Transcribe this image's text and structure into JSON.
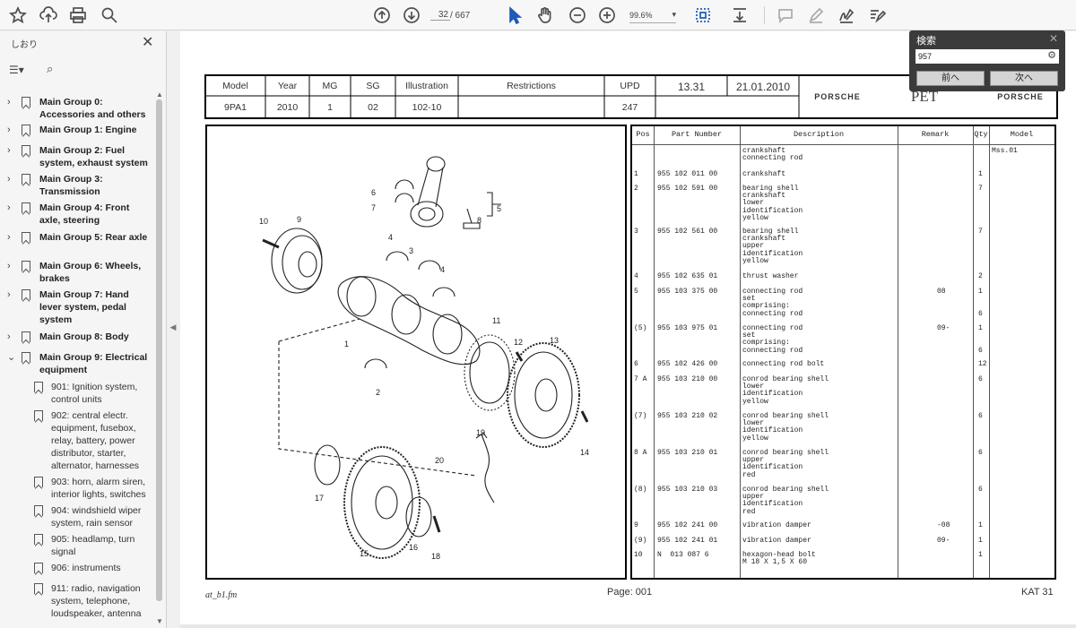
{
  "toolbar": {
    "page_current": "32",
    "page_total": "/ 667",
    "zoom": "99.6%"
  },
  "sidebar": {
    "title": "しおり",
    "items": [
      {
        "label": "Main Group 0: Accessories and others"
      },
      {
        "label": "Main Group 1: Engine"
      },
      {
        "label": "Main Group 2: Fuel system, exhaust system"
      },
      {
        "label": "Main Group 3: Transmission"
      },
      {
        "label": "Main Group 4: Front axle, steering"
      },
      {
        "label": "Main Group 5: Rear axle"
      },
      {
        "label": "Main Group 6: Wheels, brakes"
      },
      {
        "label": "Main Group 7: Hand lever system, pedal system"
      },
      {
        "label": "Main Group 8: Body"
      },
      {
        "label": "Main Group 9: Electrical equipment"
      }
    ],
    "subitems": [
      {
        "label": "901: Ignition system, control units"
      },
      {
        "label": "902: central electr. equipment, fusebox, relay, battery, power distributor, starter, alternator, harnesses"
      },
      {
        "label": "903: horn, alarm siren, interior lights, switches"
      },
      {
        "label": "904: windshield wiper system, rain sensor"
      },
      {
        "label": "905: headlamp, turn signal"
      },
      {
        "label": "906: instruments"
      },
      {
        "label": "911: radio, navigation system, telephone, loudspeaker, antenna"
      }
    ]
  },
  "header": {
    "model_label": "Model",
    "model_value": "9PA1",
    "year_label": "Year",
    "year_value": "2010",
    "mg_label": "MG",
    "mg_value": "1",
    "sg_label": "SG",
    "sg_value": "02",
    "illustration_label": "Illustration",
    "illustration_value": "102-10",
    "restrictions_label": "Restrictions",
    "upd_label": "UPD",
    "upd_value": "247",
    "num_value": "13.31",
    "date_value": "21.01.2010",
    "brand_left": "PORSCHE",
    "pet": "PET",
    "brand_right": "PORSCHE"
  },
  "parts_table": {
    "headers": [
      "Pos",
      "Part Number",
      "Description",
      "Remark",
      "Qty",
      "Model"
    ],
    "rows": [
      {
        "pos": "",
        "pn": "",
        "desc": "crankshaft\nconnecting rod",
        "remark": "",
        "qty": "",
        "model": "Mss.01"
      },
      {
        "pos": "1",
        "pn": "955 102 011 00",
        "desc": "crankshaft",
        "remark": "",
        "qty": "1",
        "model": ""
      },
      {
        "pos": "2",
        "pn": "955 102 591 00",
        "desc": "bearing shell\ncrankshaft\nlower\nidentification\nyellow",
        "remark": "",
        "qty": "7",
        "model": ""
      },
      {
        "pos": "3",
        "pn": "955 102 561 00",
        "desc": "bearing shell\ncrankshaft\nupper\nidentification\nyellow",
        "remark": "",
        "qty": "7",
        "model": ""
      },
      {
        "pos": "4",
        "pn": "955 102 635 01",
        "desc": "thrust washer",
        "remark": "",
        "qty": "2",
        "model": ""
      },
      {
        "pos": "5",
        "pn": "955 103 375 00",
        "desc": "connecting rod\nset\ncomprising:\nconnecting rod",
        "remark": "08",
        "qty": "1\n\n\n6",
        "model": ""
      },
      {
        "pos": "(5)",
        "pn": "955 103 975 01",
        "desc": "connecting rod\nset\ncomprising:\nconnecting rod",
        "remark": "09-",
        "qty": "1\n\n\n6",
        "model": ""
      },
      {
        "pos": "6",
        "pn": "955 102 426 00",
        "desc": "connecting rod bolt",
        "remark": "",
        "qty": "12",
        "model": ""
      },
      {
        "pos": "7 A",
        "pn": "955 103 210 00",
        "desc": "conrod bearing shell\nlower\nidentification\nyellow",
        "remark": "",
        "qty": "6",
        "model": ""
      },
      {
        "pos": "(7)",
        "pn": "955 103 210 02",
        "desc": "conrod bearing shell\nlower\nidentification\nyellow",
        "remark": "",
        "qty": "6",
        "model": ""
      },
      {
        "pos": "8 A",
        "pn": "955 103 210 01",
        "desc": "conrod bearing shell\nupper\nidentification\nred",
        "remark": "",
        "qty": "6",
        "model": ""
      },
      {
        "pos": "(8)",
        "pn": "955 103 210 03",
        "desc": "conrod bearing shell\nupper\nidentification\nred",
        "remark": "",
        "qty": "6",
        "model": ""
      },
      {
        "pos": "9",
        "pn": "955 102 241 00",
        "desc": "vibration damper",
        "remark": "-08",
        "qty": "1",
        "model": ""
      },
      {
        "pos": "(9)",
        "pn": "955 102 241 01",
        "desc": "vibration damper",
        "remark": "09-",
        "qty": "1",
        "model": ""
      },
      {
        "pos": "10",
        "pn": "N  013 087 6",
        "desc": "hexagon-head bolt\nM 18 X 1,5 X 60",
        "remark": "",
        "qty": "1",
        "model": ""
      }
    ]
  },
  "illustration_callouts": [
    "1",
    "2",
    "3",
    "4",
    "4",
    "5",
    "6",
    "7",
    "8",
    "9",
    "10",
    "11",
    "12",
    "13",
    "14",
    "15",
    "16",
    "17",
    "18",
    "19",
    "20"
  ],
  "footer": {
    "file": "at_b1.fm",
    "page": "Page: 001",
    "kat": "KAT 31"
  },
  "search": {
    "title": "検索",
    "value": "957",
    "prev": "前へ",
    "next": "次へ"
  }
}
